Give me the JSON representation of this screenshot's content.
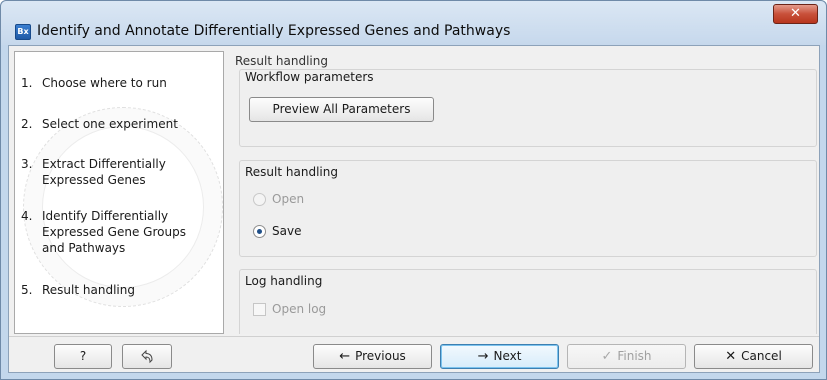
{
  "window": {
    "title": "Identify and Annotate Differentially Expressed Genes and Pathways",
    "app_icon_text": "Bx",
    "close_glyph": "✕"
  },
  "steps": [
    {
      "num": "1.",
      "label": "Choose where to run"
    },
    {
      "num": "2.",
      "label": "Select one experiment"
    },
    {
      "num": "3.",
      "label": "Extract Differentially Expressed Genes"
    },
    {
      "num": "4.",
      "label": "Identify Differentially Expressed Gene Groups and Pathways"
    },
    {
      "num": "5.",
      "label": "Result handling"
    }
  ],
  "main": {
    "title": "Result handling",
    "workflow_group": {
      "label": "Workflow parameters",
      "preview_button": "Preview All Parameters"
    },
    "result_group": {
      "label": "Result handling",
      "open_label": "Open",
      "save_label": "Save",
      "selected": "Save"
    },
    "log_group": {
      "label": "Log handling",
      "open_log_label": "Open log"
    }
  },
  "footer": {
    "help_label": "?",
    "previous_label": "Previous",
    "next_label": "Next",
    "finish_label": "Finish",
    "cancel_label": "Cancel"
  },
  "icons": {
    "previous": "arrow-left-icon",
    "next": "arrow-right-icon",
    "finish": "checkmark-icon",
    "cancel": "x-icon",
    "reset": "undo-hand-icon"
  },
  "colors": {
    "close_button": "#c8503a",
    "title_bar": "#c6d8ec",
    "default_button_border": "#3c7fb1"
  }
}
